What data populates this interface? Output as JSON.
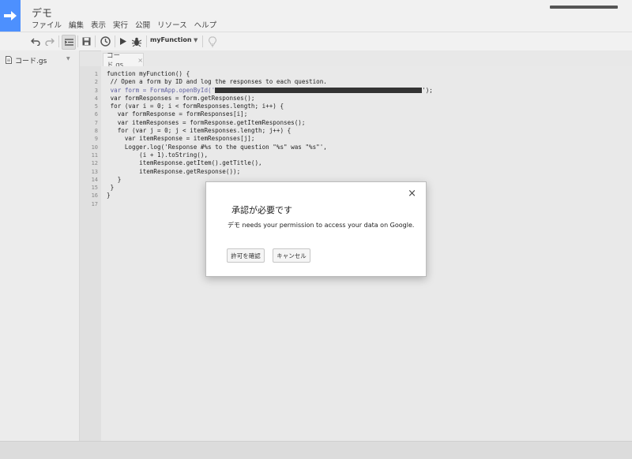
{
  "app": {
    "title": "デモ",
    "menu": [
      "ファイル",
      "編集",
      "表示",
      "実行",
      "公開",
      "リソース",
      "ヘルプ"
    ]
  },
  "toolbar": {
    "function_name": "myFunction",
    "icons": [
      "undo-icon",
      "redo-icon",
      "indent-icon",
      "save-icon",
      "triggers-icon",
      "run-icon",
      "debug-icon",
      "lightbulb-icon"
    ]
  },
  "sidebar": {
    "files": [
      {
        "label": "コード.gs"
      }
    ]
  },
  "editor": {
    "tab_label": "コード.gs",
    "tab_close": "×",
    "line_numbers": [
      "1",
      "2",
      "3",
      "4",
      "5",
      "6",
      "7",
      "8",
      "9",
      "10",
      "11",
      "12",
      "13",
      "14",
      "15",
      "16",
      "17"
    ],
    "code": {
      "l1": "function myFunction() {",
      "l2": " // Open a form by ID and log the responses to each question.",
      "l3a": " var form = FormApp.openById('",
      "l3b": "');",
      "l4": " var formResponses = form.getResponses();",
      "l5": " for (var i = 0; i < formResponses.length; i++) {",
      "l6": "   var formResponse = formResponses[i];",
      "l7": "   var itemResponses = formResponse.getItemResponses();",
      "l8": "   for (var j = 0; j < itemResponses.length; j++) {",
      "l9": "     var itemResponse = itemResponses[j];",
      "l10": "     Logger.log('Response #%s to the question \"%s\" was \"%s\"',",
      "l11": "         (i + 1).toString(),",
      "l12": "         itemResponse.getItem().getTitle(),",
      "l13": "         itemResponse.getResponse());",
      "l14": "   }",
      "l15": " }",
      "l16": "}",
      "l17": ""
    }
  },
  "dialog": {
    "title": "承認が必要です",
    "message": "デモ needs your permission to access your data on Google.",
    "close": "×",
    "review_button": "許可を確認",
    "cancel_button": "キャンセル"
  },
  "colors": {
    "accent": "#4d90fe",
    "keyword": "#000080",
    "comment": "#a0522d"
  }
}
